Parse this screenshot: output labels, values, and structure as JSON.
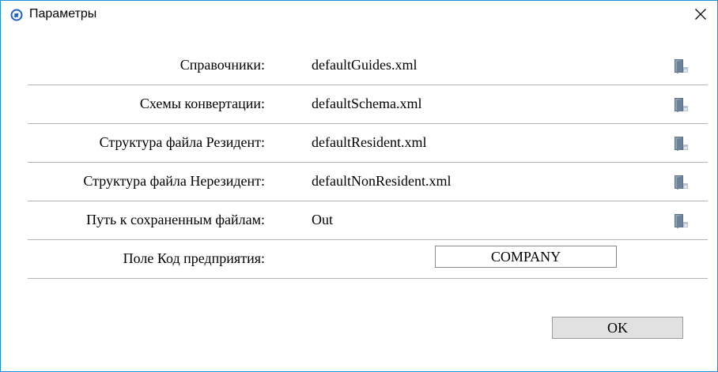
{
  "window": {
    "title": "Параметры",
    "close_glyph": "✕",
    "app_icon": "circle-arrow-icon",
    "accent_color": "#1e90d8"
  },
  "settings": {
    "rows": [
      {
        "label": "Справочники:",
        "value": "defaultGuides.xml",
        "browse_icon": "folder-browse-icon"
      },
      {
        "label": "Схемы конвертации:",
        "value": "defaultSchema.xml",
        "browse_icon": "folder-browse-icon"
      },
      {
        "label": "Структура файла Резидент:",
        "value": "defaultResident.xml",
        "browse_icon": "folder-browse-icon"
      },
      {
        "label": "Структура файла Нерезидент:",
        "value": "defaultNonResident.xml",
        "browse_icon": "folder-browse-icon"
      },
      {
        "label": "Путь к сохраненным файлам:",
        "value": "Out",
        "browse_icon": "folder-browse-icon"
      }
    ],
    "company_label": "Поле Код предприятия:",
    "company_value": "COMPANY"
  },
  "footer": {
    "ok_label": "OK"
  }
}
